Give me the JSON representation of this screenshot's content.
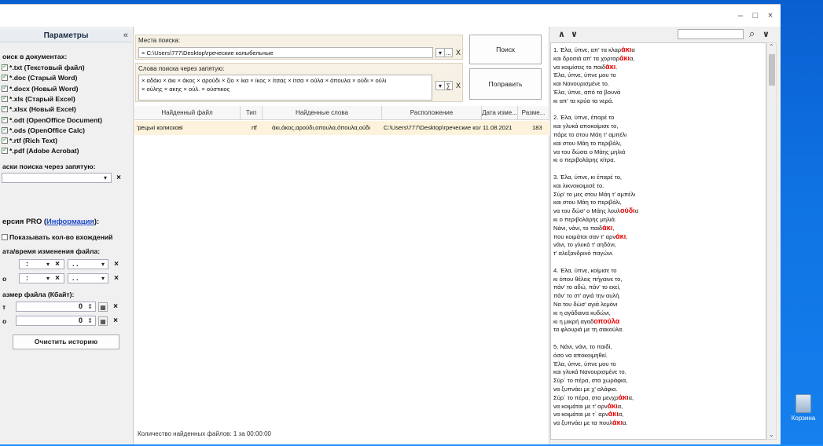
{
  "window": {
    "minimize": "–",
    "maximize": "□",
    "close": "×"
  },
  "left": {
    "title": "Параметры",
    "collapse": "«",
    "search_in_docs": "оиск в документах:",
    "types": [
      "*.txt (Текстовый файл)",
      "*.doc (Старый Word)",
      "*.docx (Новый Word)",
      "*.xls (Старый Excel)",
      "*.xlsx (Новый Excel)",
      "*.odt (OpenOffice Document)",
      "*.ods (OpenOffice Calc)",
      "*.rtf (Rich Text)",
      "*.pdf (Adobe Acrobat)"
    ],
    "masks_label": "аски поиска через запятую:",
    "pro_label_a": "ерсия PRO (",
    "pro_link": "Информация",
    "pro_label_b": "):",
    "show_count": "Показывать кол-во вхождений",
    "date_label": "ата/время изменения файла:",
    "date_from_prefix": "",
    "date_to_prefix": "о",
    "date_sep": ":",
    "date_dots": ". .",
    "size_label": "азмер файла (Кбайт):",
    "size_from_prefix": "т",
    "size_to_prefix": "о",
    "size_from_value": "0",
    "size_to_value": "0",
    "clear_button": "Очистить историю",
    "x": "×",
    "drop": "▾"
  },
  "main": {
    "places_label": "Места поиска:",
    "places_value": "× C:\\Users\\777\\Desktop\\греческие колыбельные",
    "words_label": "Слова поиска через запятую:",
    "words_line1": "× αδάκι × άκι × άκος × αρούδι × ζίο × ίκα × ίκος × ίτσας × ίτσα × ούλα × όπουλα × ούδι × ούλι",
    "words_line2": "× ούλης × ακης × ούλ. × ούστικος",
    "search_button": "Поиск",
    "reset_button": "Поправить",
    "ellipsis": "...",
    "x": "X",
    "drop": "▾",
    "sum": "∑",
    "headers": [
      "Найденный файл",
      "Тип",
      "Найденные слова",
      "Расположение",
      "Дата изме...",
      "Разме..."
    ],
    "row": {
      "file": "'рецькі колискові",
      "type": "rtf",
      "words": "άκι,άκος,αρούδι,οπουλα,όπουλα,ούδι",
      "location": "C:\\Users\\777\\Desktop\\греческие колыб...",
      "date": "11.08.2021",
      "size": "183"
    },
    "status": "Количество найденных файлов: 1 за 00:00:00"
  },
  "right": {
    "up": "∧",
    "down": "∨",
    "search_placeholder": "",
    "search_icon": "⌕",
    "lines": [
      {
        "a": "1. Έλα, ύπνε, απ' τα κλαρ",
        "h": "άκι",
        "b": "α"
      },
      {
        "a": "και δροσιά απ' τα χορταρ",
        "h": "άκι",
        "b": "α,"
      },
      {
        "a": "να κοιμίσεις το παιδ",
        "h": "άκι",
        "b": "."
      },
      {
        "a": "Έλα, ύπνε, ύπνε μου το",
        "h": "",
        "b": ""
      },
      {
        "a": "και Νανουρισμένε το.",
        "h": "",
        "b": ""
      },
      {
        "a": "Έλα, ύπνε, από τα βουνά",
        "h": "",
        "b": ""
      },
      {
        "a": "κι απ' τα κρύα τα νερά.",
        "h": "",
        "b": ""
      },
      {
        "a": "",
        "h": "",
        "b": ""
      },
      {
        "a": "2. Έλα, ύπνε, έπαρέ το",
        "h": "",
        "b": ""
      },
      {
        "a": "και γλυκά αποκοίμισε το,",
        "h": "",
        "b": ""
      },
      {
        "a": "πάρε το στου Μάη τ' αμπέλι",
        "h": "",
        "b": ""
      },
      {
        "a": "και στου Μάη το περιβόλι,",
        "h": "",
        "b": ""
      },
      {
        "a": "να του δώσει ο Μάης μηλιά",
        "h": "",
        "b": ""
      },
      {
        "a": "κι ο περιβολάρης κίτρα.",
        "h": "",
        "b": ""
      },
      {
        "a": "",
        "h": "",
        "b": ""
      },
      {
        "a": "3. Έλα, ύπνε, κι έπαρέ το,",
        "h": "",
        "b": ""
      },
      {
        "a": "και λικνοκοιμισέ το.",
        "h": "",
        "b": ""
      },
      {
        "a": "Σύρ' το μες στου Μάη τ' αμπέλι",
        "h": "",
        "b": ""
      },
      {
        "a": "και στου Μάη το περιβόλι,",
        "h": "",
        "b": ""
      },
      {
        "a": "να του δώσ' ο Μάης λουλ",
        "h": "ούδι",
        "b": "α"
      },
      {
        "a": "κι ο περιβολάρης μηλιά.",
        "h": "",
        "b": ""
      },
      {
        "a": "Νάνι, νάνι, το παιδ",
        "h": "άκι",
        "b": ","
      },
      {
        "a": "που κοιμάται σαν τ' αρν",
        "h": "άκι",
        "b": ","
      },
      {
        "a": "νάνι, το γλυκό τ' αηδόνι,",
        "h": "",
        "b": ""
      },
      {
        "a": "τ' αλεξανδρινό παγώνι.",
        "h": "",
        "b": ""
      },
      {
        "a": "",
        "h": "",
        "b": ""
      },
      {
        "a": "4. Έλα, ύπνε, κοίμισε το",
        "h": "",
        "b": ""
      },
      {
        "a": "κι όπου θέλεις πήγαινε το,",
        "h": "",
        "b": ""
      },
      {
        "a": "πάν' το αδώ, πάν' το εκεί,",
        "h": "",
        "b": ""
      },
      {
        "a": "πάν' το στ' αγιά την αυλή.",
        "h": "",
        "b": ""
      },
      {
        "a": "Να του δώσ' αγιά λεμόνι",
        "h": "",
        "b": ""
      },
      {
        "a": "κι η αγάδαινα κυδώνι,",
        "h": "",
        "b": ""
      },
      {
        "a": "κι η μικρή αγαδ",
        "h": "οπούλα",
        "b": ""
      },
      {
        "a": "τα φλουριά με τη σακούλα.",
        "h": "",
        "b": ""
      },
      {
        "a": "",
        "h": "",
        "b": ""
      },
      {
        "a": "5. Νάνι, νάνι, το παιδί,",
        "h": "",
        "b": ""
      },
      {
        "a": "όσο να αποκοιμηθεί.",
        "h": "",
        "b": ""
      },
      {
        "a": "Έλα, ύπνε, ύπνε μου το",
        "h": "",
        "b": ""
      },
      {
        "a": "και γλυκά Νανουρισμένε το.",
        "h": "",
        "b": ""
      },
      {
        "a": "Σύρ` το πέρα, στα χωράφια,",
        "h": "",
        "b": ""
      },
      {
        "a": "να ξυπνάει με χ' αλάφια.",
        "h": "",
        "b": ""
      },
      {
        "a": "Σύρ` το πέρα, στα μενχρ",
        "h": "άκι",
        "b": "α,"
      },
      {
        "a": "να κοιμάται με τ' αρν",
        "h": "άκι",
        "b": "α,"
      },
      {
        "a": "να κοιμάται με τ` αρν",
        "h": "άκι",
        "b": "α,"
      },
      {
        "a": "να ξυπνάει με τα πουλ",
        "h": "άκι",
        "b": "α."
      }
    ]
  },
  "desktop": {
    "recycle_bin": "Корзина"
  }
}
